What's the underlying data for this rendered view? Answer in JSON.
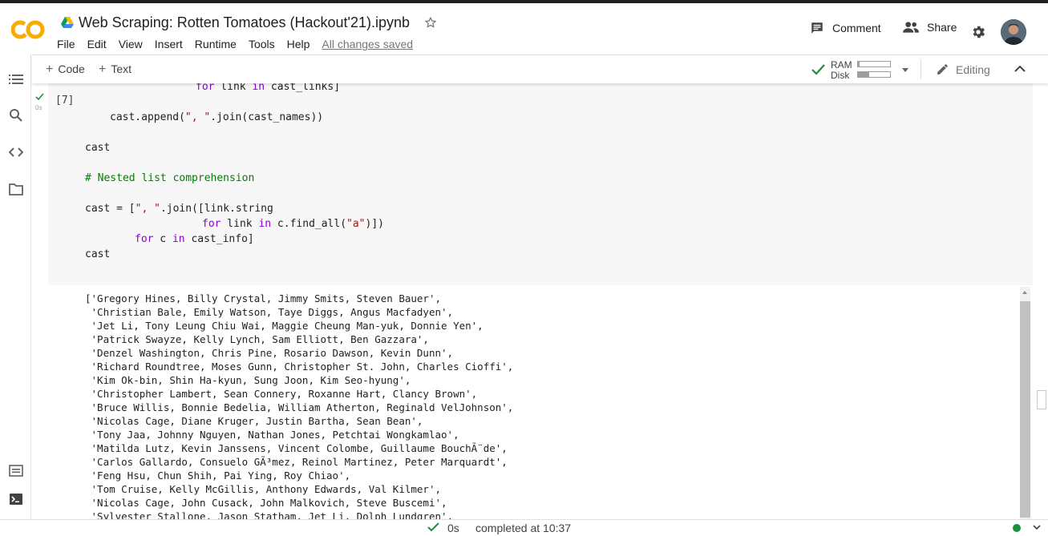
{
  "header": {
    "logo_text": "CO",
    "notebook_title": "Web Scraping: Rotten Tomatoes (Hackout'21).ipynb",
    "menu": [
      "File",
      "Edit",
      "View",
      "Insert",
      "Runtime",
      "Tools",
      "Help"
    ],
    "save_status": "All changes saved",
    "comment_label": "Comment",
    "share_label": "Share"
  },
  "toolbar": {
    "add_code_label": "Code",
    "add_text_label": "Text",
    "ram_label": "RAM",
    "disk_label": "Disk",
    "ram_usage_fraction": 0.05,
    "disk_usage_fraction": 0.35,
    "editing_label": "Editing"
  },
  "cell": {
    "execution_count": "[7]",
    "run_time": "0s",
    "code_lines": [
      {
        "parts": [
          {
            "t": "for",
            "c": "kw"
          },
          {
            "t": " link "
          },
          {
            "t": "in",
            "c": "kw"
          },
          {
            "t": " cast_links]"
          }
        ]
      },
      {
        "parts": [
          {
            "t": "cast.append("
          },
          {
            "t": "\", \"",
            "c": "str"
          },
          {
            "t": ".join(cast_names))"
          }
        ]
      },
      {
        "parts": [
          {
            "t": "cast"
          }
        ]
      },
      {
        "parts": [
          {
            "t": "# Nested list comprehension",
            "c": "cmt"
          }
        ]
      },
      {
        "parts": [
          {
            "t": "cast = ["
          },
          {
            "t": "\", \"",
            "c": "str"
          },
          {
            "t": ".join([link.string"
          }
        ]
      },
      {
        "parts": [
          {
            "t": "for",
            "c": "kw"
          },
          {
            "t": " link "
          },
          {
            "t": "in",
            "c": "kw"
          },
          {
            "t": " c.find_all("
          },
          {
            "t": "\"a\"",
            "c": "str"
          },
          {
            "t": ")])"
          }
        ]
      },
      {
        "parts": [
          {
            "t": "for",
            "c": "kw"
          },
          {
            "t": " c "
          },
          {
            "t": "in",
            "c": "kw"
          },
          {
            "t": " cast_info]"
          }
        ]
      },
      {
        "parts": [
          {
            "t": "cast"
          }
        ]
      }
    ]
  },
  "output_lines": [
    "['Gregory Hines, Billy Crystal, Jimmy Smits, Steven Bauer',",
    " 'Christian Bale, Emily Watson, Taye Diggs, Angus Macfadyen',",
    " 'Jet Li, Tony Leung Chiu Wai, Maggie Cheung Man-yuk, Donnie Yen',",
    " 'Patrick Swayze, Kelly Lynch, Sam Elliott, Ben Gazzara',",
    " 'Denzel Washington, Chris Pine, Rosario Dawson, Kevin Dunn',",
    " 'Richard Roundtree, Moses Gunn, Christopher St. John, Charles Cioffi',",
    " 'Kim Ok-bin, Shin Ha-kyun, Sung Joon, Kim Seo-hyung',",
    " 'Christopher Lambert, Sean Connery, Roxanne Hart, Clancy Brown',",
    " 'Bruce Willis, Bonnie Bedelia, William Atherton, Reginald VelJohnson',",
    " 'Nicolas Cage, Diane Kruger, Justin Bartha, Sean Bean',",
    " 'Tony Jaa, Johnny Nguyen, Nathan Jones, Petchtai Wongkamlao',",
    " 'Matilda Lutz, Kevin Janssens, Vincent Colombe, Guillaume BouchÃ¨de',",
    " 'Carlos Gallardo, Consuelo GÃ³mez, Reinol Martinez, Peter Marquardt',",
    " 'Feng Hsu, Chun Shih, Pai Ying, Roy Chiao',",
    " 'Tom Cruise, Kelly McGillis, Anthony Edwards, Val Kilmer',",
    " 'Nicolas Cage, John Cusack, John Malkovich, Steve Buscemi',",
    " 'Sylvester Stallone, Jason Statham, Jet Li, Dolph Lundgren',"
  ],
  "statusbar": {
    "run_time": "0s",
    "completed_text": "completed at 10:37"
  },
  "colors": {
    "logo_orange": "#f9ab00",
    "check_green": "#1e8e3e",
    "keyword": "#8b00d6",
    "string": "#a31515",
    "comment": "#008000"
  },
  "icons": [
    "menu-icon",
    "search-icon",
    "code-icon",
    "folder-icon",
    "terminal-list-icon",
    "terminal-icon",
    "comment-icon",
    "share-icon",
    "gear-icon",
    "pencil-icon",
    "chevron-up-icon",
    "check-icon",
    "star-icon",
    "drive-icon"
  ]
}
